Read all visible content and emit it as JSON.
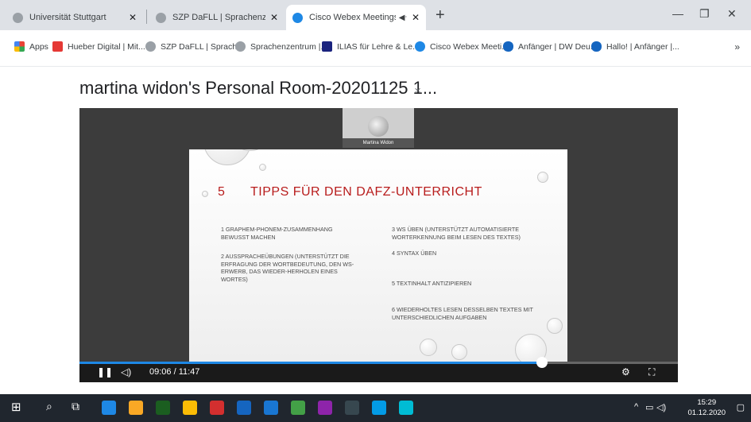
{
  "browser": {
    "tabs": [
      {
        "title": "Universität Stuttgart",
        "active": false,
        "favicon_color": "#9aa0a6"
      },
      {
        "title": "SZP DaFLL | Sprachenzentrum | U",
        "active": false,
        "favicon_color": "#9aa0a6"
      },
      {
        "title": "Cisco Webex Meetings - Rep",
        "active": true,
        "favicon_color": "#1e88e5"
      }
    ],
    "bookmarks": [
      {
        "label": "Apps",
        "icon": "apps-grid-icon",
        "color": "#e53935"
      },
      {
        "label": "Hueber Digital | Mit...",
        "icon": "hueber-icon",
        "color": "#e53935"
      },
      {
        "label": "SZP DaFLL | Sprach...",
        "icon": "uni-icon",
        "color": "#9aa0a6"
      },
      {
        "label": "Sprachenzentrum |...",
        "icon": "uni-icon",
        "color": "#9aa0a6"
      },
      {
        "label": "ILIAS für Lehre & Le...",
        "icon": "ilias-icon",
        "color": "#1a237e"
      },
      {
        "label": "Cisco Webex Meeti...",
        "icon": "webex-icon",
        "color": "#1e88e5"
      },
      {
        "label": "Anfänger | DW Deu...",
        "icon": "dw-icon",
        "color": "#1565c0"
      },
      {
        "label": "Hallo! | Anfänger |...",
        "icon": "dw-icon",
        "color": "#1565c0"
      }
    ]
  },
  "page": {
    "title": "martina widon's Personal Room-20201125 1..."
  },
  "player": {
    "participant_name": "Martina Widon",
    "time": "09:06 / 11:47",
    "progress": 0.773
  },
  "slide": {
    "number": "5",
    "heading": "TIPPS FÜR DEN DAFZ-UNTERRICHT",
    "left_items": [
      "1 Graphem-Phonem-Zusammenhang bewusst machen",
      "2 Ausspracheübungen (unterstützt die Erfragung der Wortbedeutung, den Ws-Erwerb, das Wieder-Herholen eines Wortes)"
    ],
    "right_items": [
      "3 Ws üben (unterstützt automatisierte Worterkennung beim Lesen des Textes)",
      "4 Syntax üben",
      "5 Textinhalt antizipieren",
      "6 Wiederholtes Lesen desselben Textes mit unterschiedlichen Aufgaben"
    ]
  },
  "taskbar": {
    "time": "15:29",
    "date": "01.12.2020",
    "apps": [
      {
        "icon": "edge-icon",
        "color": "#1e88e5"
      },
      {
        "icon": "file-explorer-icon",
        "color": "#f9a825"
      },
      {
        "icon": "excel-icon",
        "color": "#1b5e20"
      },
      {
        "icon": "chrome-icon",
        "color": "#fbbc05"
      },
      {
        "icon": "acrobat-icon",
        "color": "#d32f2f"
      },
      {
        "icon": "word-icon",
        "color": "#1565c0"
      },
      {
        "icon": "outlook-icon",
        "color": "#1976d2"
      },
      {
        "icon": "browser-icon",
        "color": "#43a047"
      },
      {
        "icon": "paint-icon",
        "color": "#8e24aa"
      },
      {
        "icon": "app-ez-icon",
        "color": "#37474f"
      },
      {
        "icon": "skype-icon",
        "color": "#039be5"
      },
      {
        "icon": "webex-icon",
        "color": "#00bcd4"
      }
    ]
  }
}
